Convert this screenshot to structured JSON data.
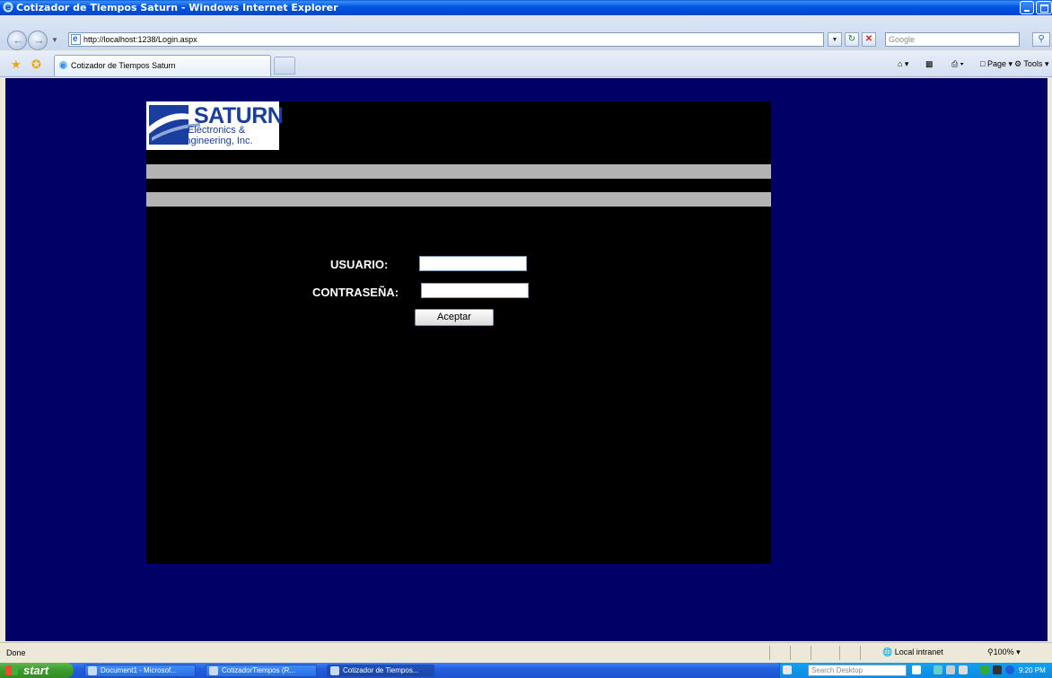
{
  "window": {
    "title": "Cotizador de Tiempos Saturn - Windows Internet Explorer"
  },
  "addressbar": {
    "url": "http://localhost:1238/Login.aspx",
    "search_placeholder": "Google"
  },
  "tab": {
    "title": "Cotizador de Tiempos Saturn"
  },
  "commandbar": {
    "page_label": "Page",
    "tools_label": "Tools"
  },
  "logo": {
    "line1": "SATURN",
    "line2": "Electronics &",
    "line3": "Engineering, Inc."
  },
  "form": {
    "usuario_label": "USUARIO:",
    "contrasena_label": "CONTRASEÑA:",
    "usuario_value": "",
    "contrasena_value": "",
    "submit_label": "Aceptar"
  },
  "statusbar": {
    "status": "Done",
    "zone": "Local intranet",
    "zoom": "100%"
  },
  "taskbar": {
    "start_label": "start",
    "tasks": [
      "Document1 - Microsof...",
      "CotizadorTiempos (R...",
      "Cotizador de Tiempos..."
    ],
    "search_placeholder": "Search Desktop",
    "clock": "9:20 PM"
  },
  "colors": {
    "page_background": "#000066",
    "panel": "#000000",
    "bars": "#b3b3b3",
    "logo_text": "#1a3ea0"
  }
}
